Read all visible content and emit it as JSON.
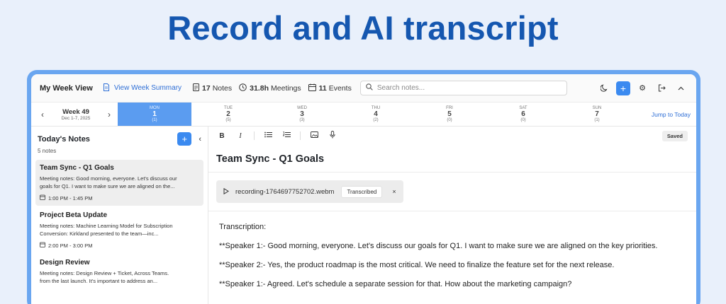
{
  "hero": {
    "title": "Record and AI transcript"
  },
  "topbar": {
    "title": "My Week View",
    "summary_link": "View Week Summary",
    "notes_count": "17",
    "notes_label": "Notes",
    "meetings_hours": "31.8h",
    "meetings_label": "Meetings",
    "events_count": "11",
    "events_label": "Events",
    "search_placeholder": "Search notes...",
    "icons": [
      "moon-icon",
      "plus-icon",
      "gear-icon",
      "logout-icon",
      "chevron-up-icon"
    ]
  },
  "weekbar": {
    "week": "Week 49",
    "range": "Dec 1-7, 2025",
    "days": [
      {
        "name": "MON",
        "num": "1",
        "count": "(1)",
        "active": true
      },
      {
        "name": "TUE",
        "num": "2",
        "count": "(5)"
      },
      {
        "name": "WED",
        "num": "3",
        "count": "(3)"
      },
      {
        "name": "THU",
        "num": "4",
        "count": "(2)"
      },
      {
        "name": "FRI",
        "num": "5",
        "count": "(0)"
      },
      {
        "name": "SAT",
        "num": "6",
        "count": "(0)"
      },
      {
        "name": "SUN",
        "num": "7",
        "count": "(1)"
      }
    ],
    "jump_label": "Jump to Today"
  },
  "sidebar": {
    "title": "Today's Notes",
    "count": "5 notes",
    "notes": [
      {
        "title": "Team Sync - Q1 Goals",
        "line1": "Meeting notes: Good morning, everyone. Let's discuss our",
        "line2": "goals for Q1. I want to make sure we are aligned on the...",
        "time": "1:00 PM - 1:45 PM"
      },
      {
        "title": "Project Beta Update",
        "line1": "Meeting notes: Machine Learning Model for Subscription",
        "line2": "Conversion: Kirkland presented to the team—inc...",
        "time": "2:00 PM - 3:00 PM"
      },
      {
        "title": "Design Review",
        "line1": "Meeting notes: Design Review + Ticket, Across Teams.",
        "line2": "from the last launch. It's important to address an...",
        "time": ""
      }
    ]
  },
  "editor": {
    "saved": "Saved",
    "title": "Team Sync - Q1 Goals",
    "recording": {
      "file": "recording-1764697752702.webm",
      "badge": "Transcribed",
      "close": "×"
    },
    "transcript_heading": "Transcription:",
    "lines": [
      "**Speaker 1:- Good morning, everyone. Let's discuss our goals for Q1. I want to make sure we are aligned on the key priorities.",
      "**Speaker 2:- Yes, the product roadmap is the most critical. We need to finalize the feature set for the next release.",
      "**Speaker 1:- Agreed. Let's schedule a separate session for that. How about the marketing campaign?"
    ]
  }
}
